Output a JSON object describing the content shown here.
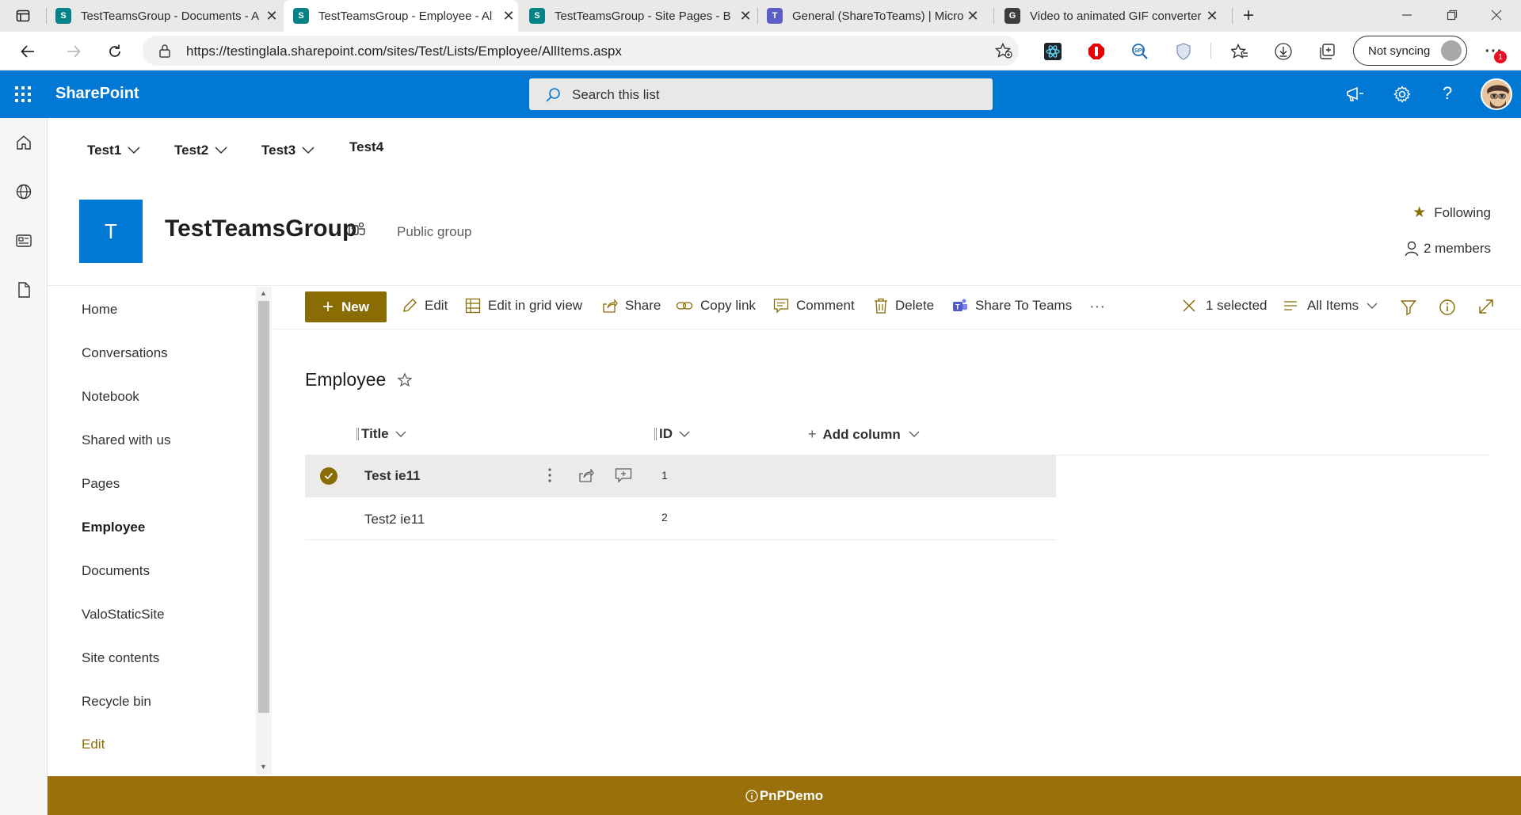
{
  "browser": {
    "tabs": [
      {
        "title": "TestTeamsGroup - Documents - A",
        "icon": "sharepoint-icon"
      },
      {
        "title": "TestTeamsGroup - Employee - Al",
        "icon": "sharepoint-icon"
      },
      {
        "title": "TestTeamsGroup - Site Pages - B",
        "icon": "sharepoint-icon"
      },
      {
        "title": "General (ShareToTeams) | Micros",
        "icon": "teams-icon"
      },
      {
        "title": "Video to animated GIF converter",
        "icon": "gif-converter-icon"
      }
    ],
    "url": "https://testinglala.sharepoint.com/sites/Test/Lists/Employee/AllItems.aspx",
    "sync_label": "Not syncing",
    "notification_count": "1"
  },
  "suite": {
    "brand": "SharePoint",
    "search_placeholder": "Search this list"
  },
  "topnav": [
    "Test1",
    "Test2",
    "Test3",
    "Test4"
  ],
  "site": {
    "logo_letter": "T",
    "title": "TestTeamsGroup",
    "group_type": "Public group",
    "following": "Following",
    "members": "2 members"
  },
  "leftnav": [
    "Home",
    "Conversations",
    "Notebook",
    "Shared with us",
    "Pages",
    "Employee",
    "Documents",
    "ValoStaticSite",
    "Site contents",
    "Recycle bin"
  ],
  "leftnav_edit": "Edit",
  "commands": {
    "new": "New",
    "edit": "Edit",
    "edit_grid": "Edit in grid view",
    "share": "Share",
    "copy_link": "Copy link",
    "comment": "Comment",
    "delete": "Delete",
    "share_teams": "Share To Teams",
    "more": "···",
    "selected": "1 selected",
    "view": "All Items"
  },
  "list": {
    "title": "Employee",
    "columns": {
      "title": "Title",
      "id": "ID",
      "add": "Add column"
    },
    "rows": [
      {
        "title": "Test ie11",
        "id": "1",
        "selected": true
      },
      {
        "title": "Test2 ie11",
        "id": "2",
        "selected": false
      }
    ]
  },
  "footer": "PnPDemo",
  "colors": {
    "suite": "#0078d4",
    "accent": "#8a6c05",
    "footer": "#9a700a"
  }
}
